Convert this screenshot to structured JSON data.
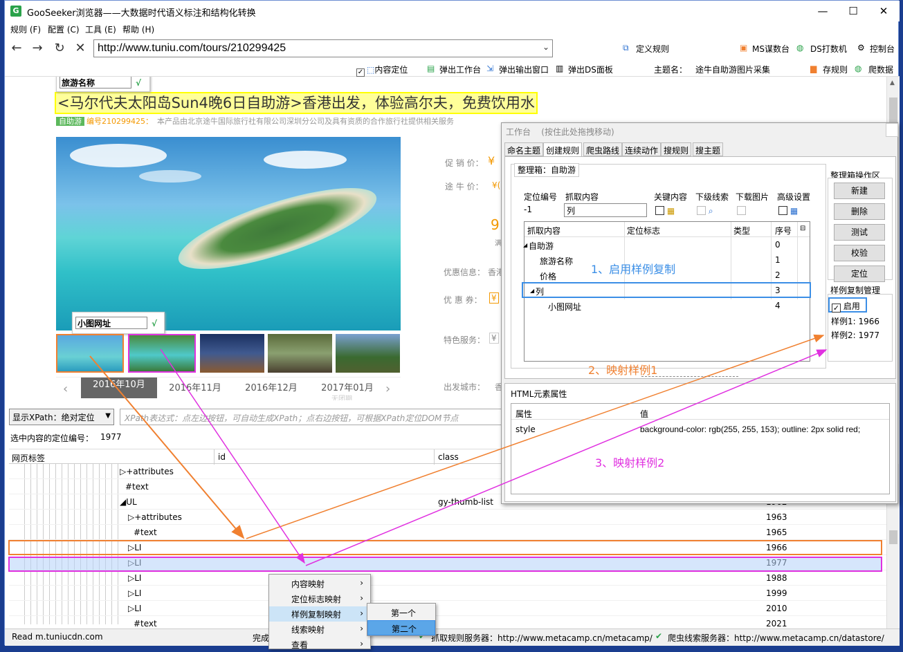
{
  "window": {
    "app_icon": "G",
    "title": "GooSeeker浏览器——大数据时代语义标注和结构化转换",
    "min": "—",
    "max": "☐",
    "close": "✕"
  },
  "menu": [
    "规则 (F)",
    "配置 (C)",
    "工具 (E)",
    "帮助 (H)"
  ],
  "nav": {
    "url": "http://www.tuniu.com/tours/210299425",
    "define_rule": "定义规则",
    "ms": "MS谋数台",
    "ds": "DS打数机",
    "console": "控制台"
  },
  "toolbar2": {
    "content_locate": "内容定位",
    "popup_workbench": "弹出工作台",
    "popup_output": "弹出输出窗口",
    "popup_ds": "弹出DS面板",
    "theme_label": "主题名：",
    "theme_value": "途牛自助游图片采集",
    "save_rule": "存规则",
    "crawl": "爬数据"
  },
  "page": {
    "title_tip": "旅游名称",
    "ok": "√",
    "headline": "<马尔代夫太阳岛Sun4晚6日自助游>香港出发，体验高尔夫，免费饮用水",
    "badge": "自助游",
    "product_no": "编号210299425：",
    "sub": "本产品由北京途牛国际旅行社有限公司深圳分公司及具有资质的合作旅行社提供相关服务",
    "thumb_tip": "小图网址",
    "promo_price": "促 销 价：",
    "yen": "¥",
    "tuniu_price": "途 牛 价：",
    "yen2": "¥(",
    "nine": "9",
    "satisfy": "满",
    "discount_info": "优惠信息：",
    "discount_val": "香港",
    "coupon": "优 惠 券：",
    "coupon_val": "¥",
    "special": "特色服务：",
    "special_val": "¥",
    "depart_city": "出发城市：",
    "depart_val": "香",
    "months": [
      "2016年10月",
      "2016年11月",
      "2016年12月",
      "2017年01月"
    ],
    "no_group": "无团期",
    "prev": "‹",
    "next": "›"
  },
  "workbench": {
    "title": "工作台",
    "drag_hint": "(按住此处拖拽移动)",
    "tabs": [
      "命名主题",
      "创建规则",
      "爬虫路线",
      "连续动作",
      "搜规则",
      "搜主题"
    ],
    "box_label": "整理箱：自助游",
    "locate_no_label": "定位编号",
    "locate_no": "-1",
    "grab_label": "抓取内容",
    "grab_value": "列",
    "key_content": "关键内容",
    "next_clue": "下级线索",
    "download_img": "下载图片",
    "advanced": "高级设置",
    "grid_headers": [
      "抓取内容",
      "定位标志",
      "类型",
      "序号"
    ],
    "rows": [
      {
        "name": "自助游",
        "no": "0",
        "arrow": "◢"
      },
      {
        "name": "旅游名称",
        "no": "1"
      },
      {
        "name": "价格",
        "no": "2"
      },
      {
        "name": "列",
        "no": "3",
        "arrow": "◢"
      },
      {
        "name": "小图网址",
        "no": "4"
      }
    ],
    "ops_title": "整理箱操作区",
    "ops": [
      "新建",
      "删除",
      "测试",
      "校验",
      "定位"
    ],
    "sample_title": "样例复制管理",
    "enable": "启用",
    "sample1": "样例1: 1966",
    "sample2": "样例2: 1977",
    "html_attr_title": "HTML元素属性",
    "attr_headers": [
      "属性",
      "值"
    ],
    "attr_name": "style",
    "attr_value": "background-color: rgb(255, 255, 153); outline: 2px solid red;"
  },
  "annotations": {
    "a1": "1、启用样例复制",
    "a2": "2、映射样例1",
    "a3": "3、映射样例2"
  },
  "dom": {
    "xpath_select": "显示XPath：绝对定位",
    "xpath_placeholder": "XPath表达式：点左边按钮，可自动生成XPath；点右边按钮，可根据XPath定位DOM节点",
    "selected_label": "选中内容的定位编号：",
    "selected_value": "1977",
    "cols": [
      "网页标签",
      "id",
      "class"
    ],
    "rows": [
      {
        "tag": "▷+attributes",
        "indent": 160,
        "id": "",
        "class": "",
        "no": ""
      },
      {
        "tag": "#text",
        "indent": 168,
        "id": "",
        "class": "",
        "no": ""
      },
      {
        "tag": "◢UL",
        "indent": 160,
        "id": "",
        "class": "gy-thumb-list",
        "no": "1962"
      },
      {
        "tag": "▷+attributes",
        "indent": 172,
        "id": "",
        "class": "",
        "no": "1963"
      },
      {
        "tag": "#text",
        "indent": 180,
        "id": "",
        "class": "",
        "no": "1965"
      },
      {
        "tag": "▷LI",
        "indent": 172,
        "id": "",
        "class": "",
        "no": "1966"
      },
      {
        "tag": "▷LI",
        "indent": 172,
        "id": "",
        "class": "",
        "no": "1977"
      },
      {
        "tag": "▷LI",
        "indent": 172,
        "id": "",
        "class": "",
        "no": "1988"
      },
      {
        "tag": "▷LI",
        "indent": 172,
        "id": "",
        "class": "",
        "no": "1999"
      },
      {
        "tag": "▷LI",
        "indent": 172,
        "id": "",
        "class": "",
        "no": "2010"
      },
      {
        "tag": "#text",
        "indent": 180,
        "id": "",
        "class": "",
        "no": "2021"
      }
    ]
  },
  "context_menu": {
    "items": [
      "内容映射",
      "定位标志映射",
      "样例复制映射",
      "线索映射",
      "查看"
    ],
    "sub": [
      "第一个",
      "第二个"
    ],
    "arrow": "›"
  },
  "status": {
    "left": "Read m.tuniucdn.com",
    "done": "完成",
    "grab_server": "抓取规则服务器：http://www.metacamp.cn/metacamp/",
    "clue_server": "爬虫线索服务器：http://www.metacamp.cn/datastore/"
  },
  "colors": {
    "orange": "#f08030",
    "magenta": "#e030e0",
    "blue": "#3a8ee6",
    "annot_blue": "#3a8ee6",
    "annot_orange": "#f08030",
    "annot_magenta": "#e030e0"
  }
}
